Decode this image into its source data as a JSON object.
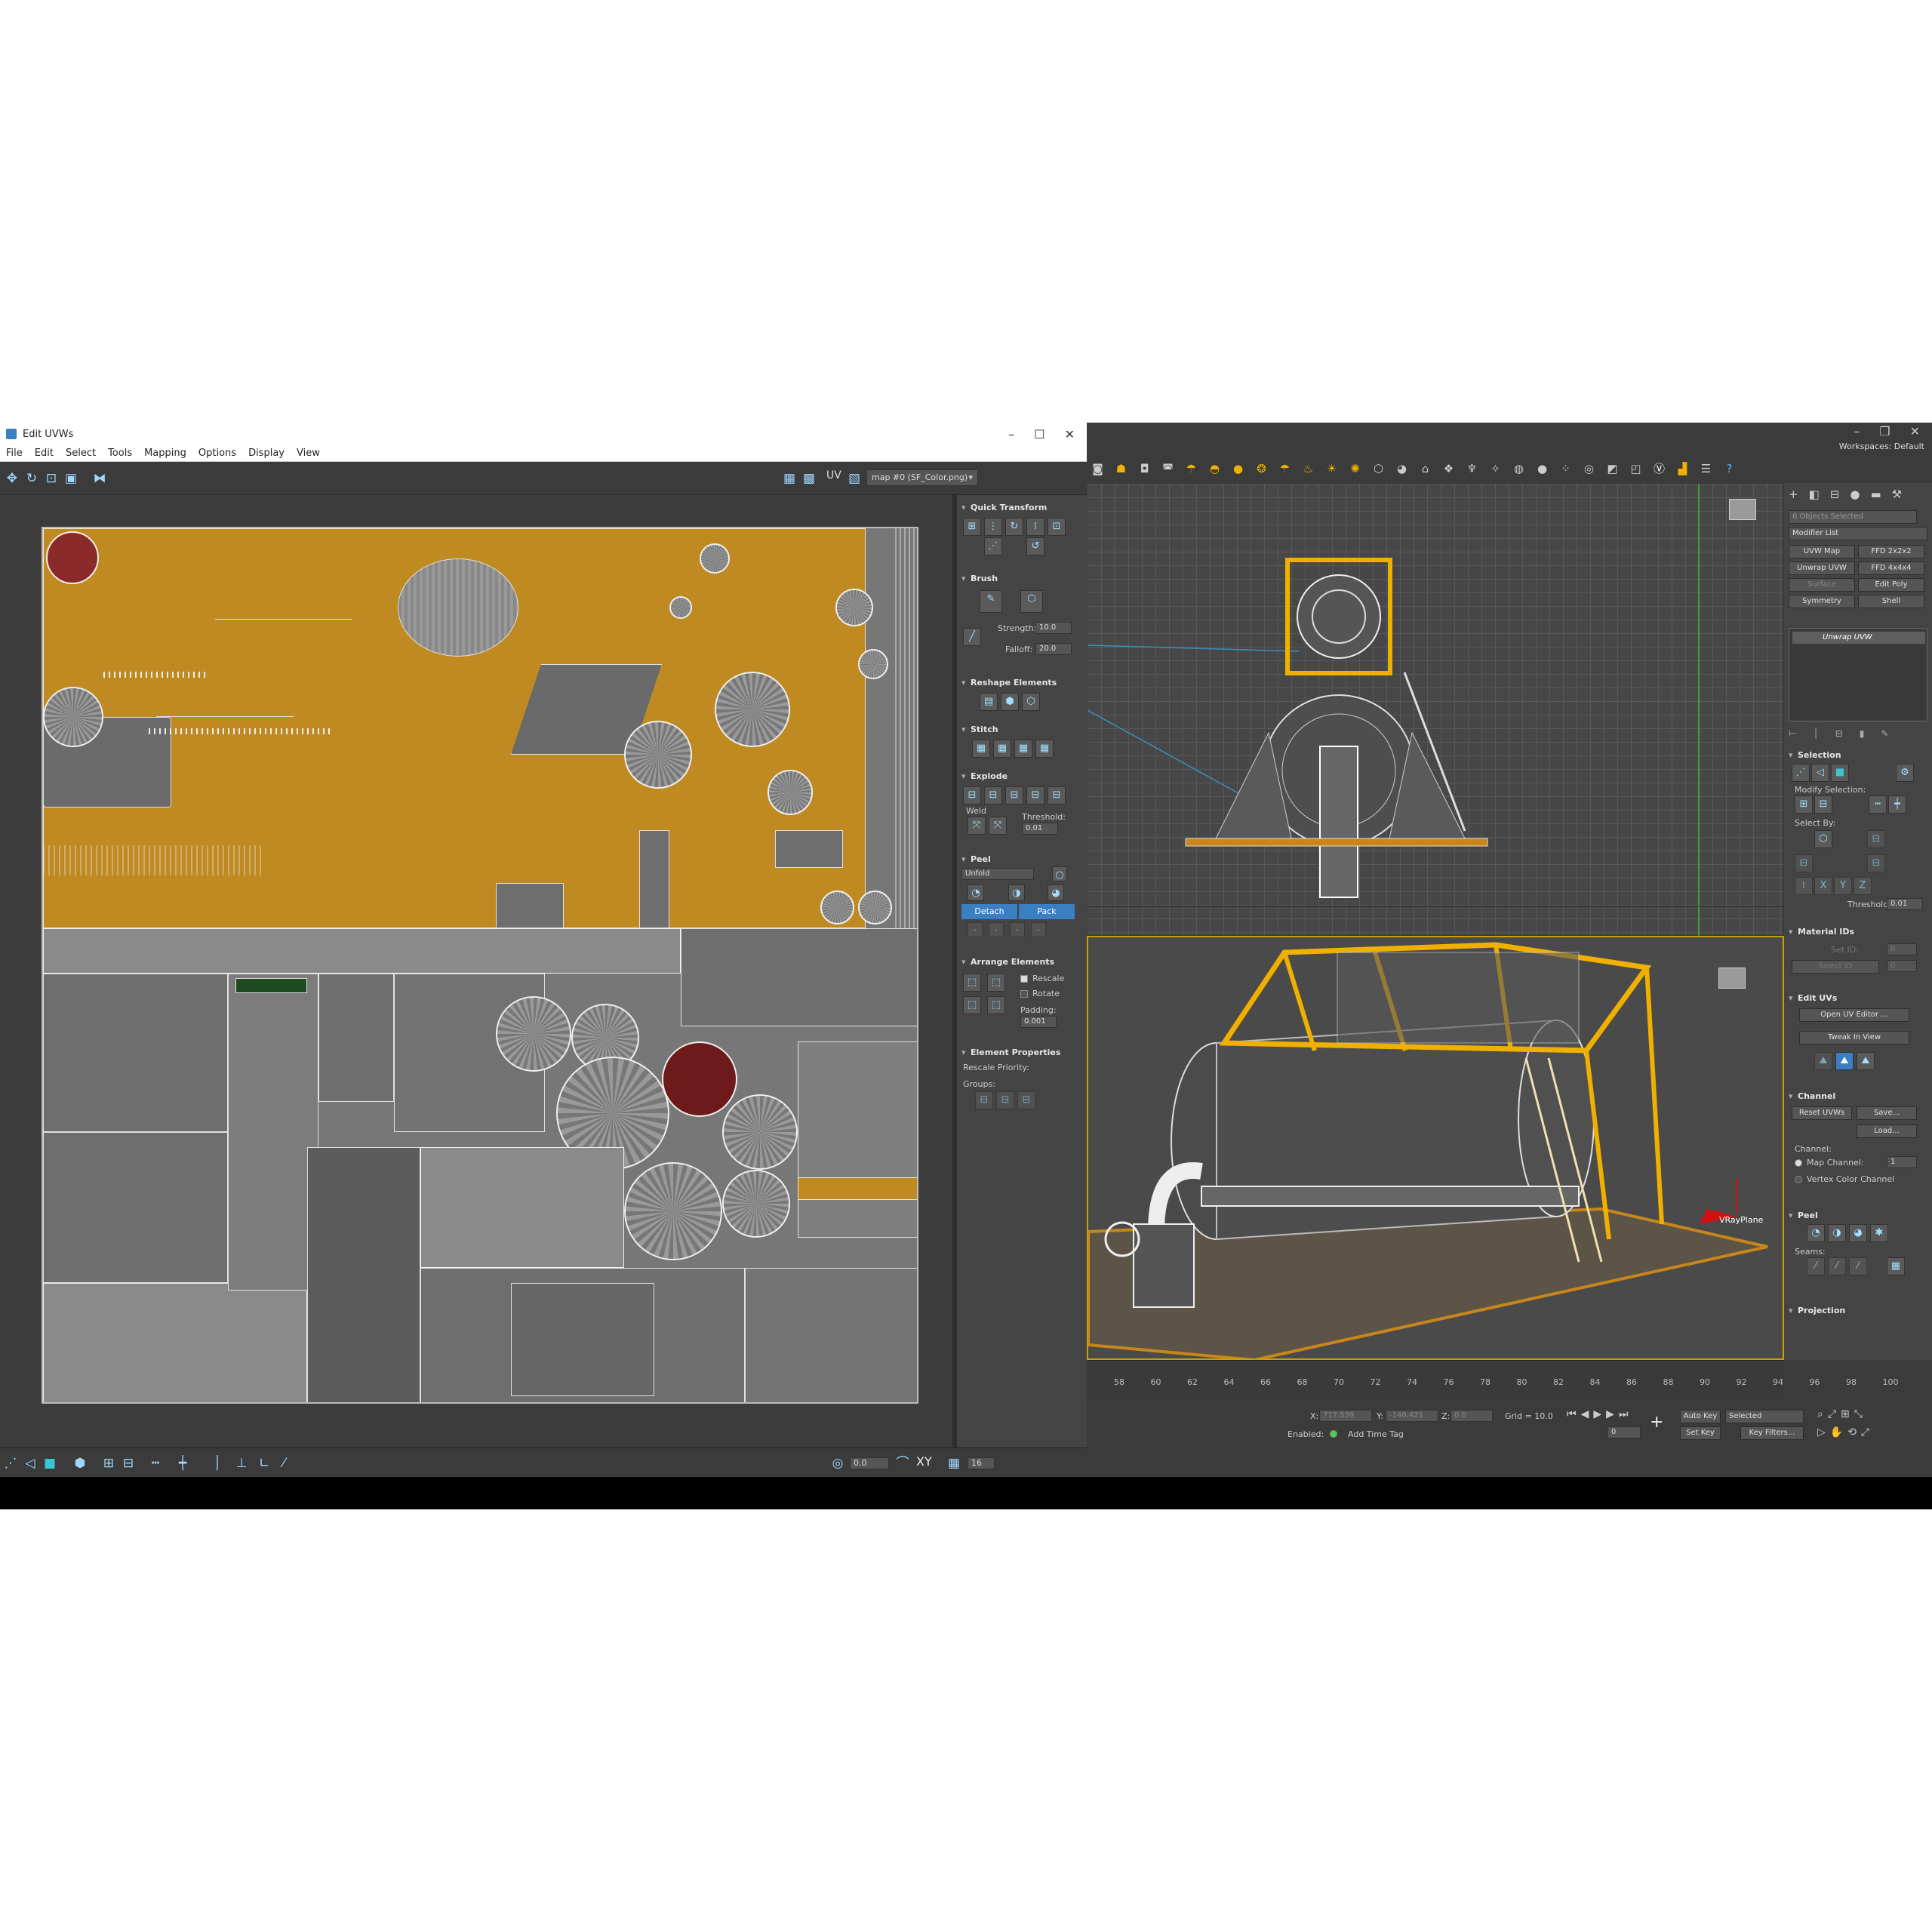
{
  "uvw_window": {
    "title": "Edit UVWs",
    "menu": [
      "File",
      "Edit",
      "Select",
      "Tools",
      "Mapping",
      "Options",
      "Display",
      "View"
    ],
    "uv_label": "UV",
    "map_dropdown": "map #0 (SF_Color.png)",
    "panel": {
      "quick_transform": "Quick Transform",
      "brush": "Brush",
      "strength_label": "Strength:",
      "strength_value": "10.0",
      "falloff_label": "Falloff:",
      "falloff_value": "20.0",
      "reshape": "Reshape Elements",
      "stitch": "Stitch",
      "explode": "Explode",
      "weld_label": "Weld",
      "threshold_label": "Threshold:",
      "threshold_value": "0.01",
      "peel": "Peel",
      "peel_mode": "Unfold",
      "detach_label": "Detach",
      "pack_label": "Pack",
      "arrange": "Arrange Elements",
      "rescale_label": "Rescale",
      "rotate_label": "Rotate",
      "padding_label": "Padding:",
      "padding_value": "0.001",
      "element_props": "Element Properties",
      "rescale_priority": "Rescale Priority:",
      "groups_label": "Groups:"
    },
    "status": {
      "value_a": "0.0",
      "xy_label": "XY",
      "value_b": "16"
    }
  },
  "max_window": {
    "workspace_label": "Workspaces:",
    "workspace_value": "Default",
    "selection_info": "6 Objects Selected",
    "modifier_list": "Modifier List",
    "modifier_buttons": [
      "UVW Map",
      "FFD 2x2x2",
      "Unwrap UVW",
      "FFD 4x4x4",
      "Surface",
      "Edit Poly",
      "Symmetry",
      "Shell"
    ],
    "stack_item": "Unwrap UVW",
    "selection_title": "Selection",
    "modify_selection": "Modify Selection:",
    "select_by": "Select By:",
    "threshold_label": "Threshold:",
    "threshold_value": "0.01",
    "material_ids": "Material IDs",
    "set_id": "Set ID:",
    "select_id": "Select ID",
    "id_value": "0",
    "edit_uvs": "Edit UVs",
    "open_uv_editor": "Open UV Editor ...",
    "tweak_in_view": "Tweak In View",
    "channel_title": "Channel",
    "reset_uvws": "Reset UVWs",
    "save_btn": "Save...",
    "load_btn": "Load...",
    "channel_label": "Channel:",
    "map_channel": "Map Channel:",
    "map_channel_value": "1",
    "vertex_color": "Vertex Color Channel",
    "peel_title": "Peel",
    "seams_label": "Seams:",
    "projection_title": "Projection",
    "vray_label": "VRayPlane",
    "vray_label_top": "VRayPlane",
    "timeline_ticks": [
      "58",
      "60",
      "62",
      "64",
      "66",
      "68",
      "70",
      "72",
      "74",
      "76",
      "78",
      "80",
      "82",
      "84",
      "86",
      "88",
      "90",
      "92",
      "94",
      "96",
      "98",
      "100"
    ],
    "status": {
      "x_label": "X:",
      "x_value": "717.539",
      "y_label": "Y:",
      "y_value": "-146.421",
      "z_label": "Z:",
      "z_value": "0.0",
      "grid": "Grid = 10.0",
      "enabled": "Enabled:",
      "add_time_tag": "Add Time Tag",
      "auto_key": "Auto Key",
      "selected": "Selected",
      "set_key": "Set Key",
      "key_filters": "Key Filters...",
      "frame_value": "0"
    }
  },
  "colors": {
    "accent_blue": "#3a7fc2",
    "viewport_active": "#c8a000",
    "uv_orange": "#c08a22"
  }
}
